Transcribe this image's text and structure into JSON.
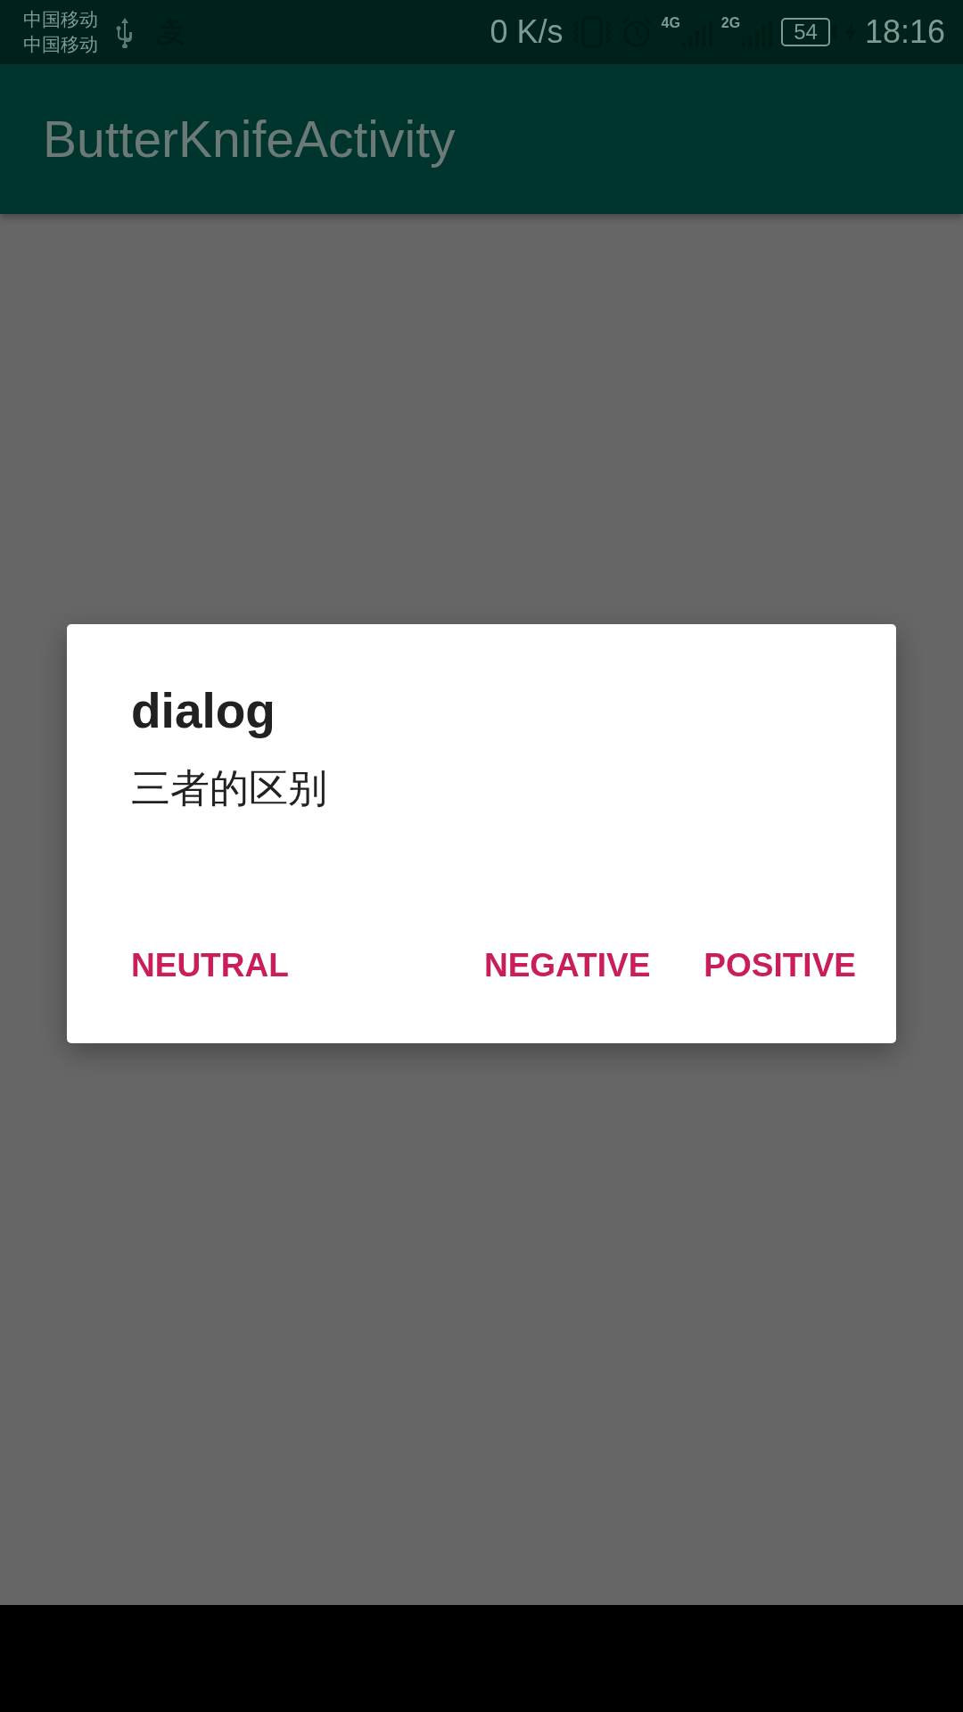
{
  "status_bar": {
    "carriers": [
      "中国移动",
      "中国移动"
    ],
    "speed": "0 K/s",
    "sim1_network": "4G",
    "sim2_network": "2G",
    "battery": "54",
    "charging": true,
    "time": "18:16"
  },
  "app_bar": {
    "title": "ButterKnifeActivity"
  },
  "dialog": {
    "title": "dialog",
    "message": "三者的区别",
    "buttons": [
      {
        "label": "NEUTRAL",
        "kind": "neutral"
      },
      {
        "label": "NEGATIVE",
        "kind": "negative"
      },
      {
        "label": "POSITIVE",
        "kind": "positive"
      }
    ]
  }
}
